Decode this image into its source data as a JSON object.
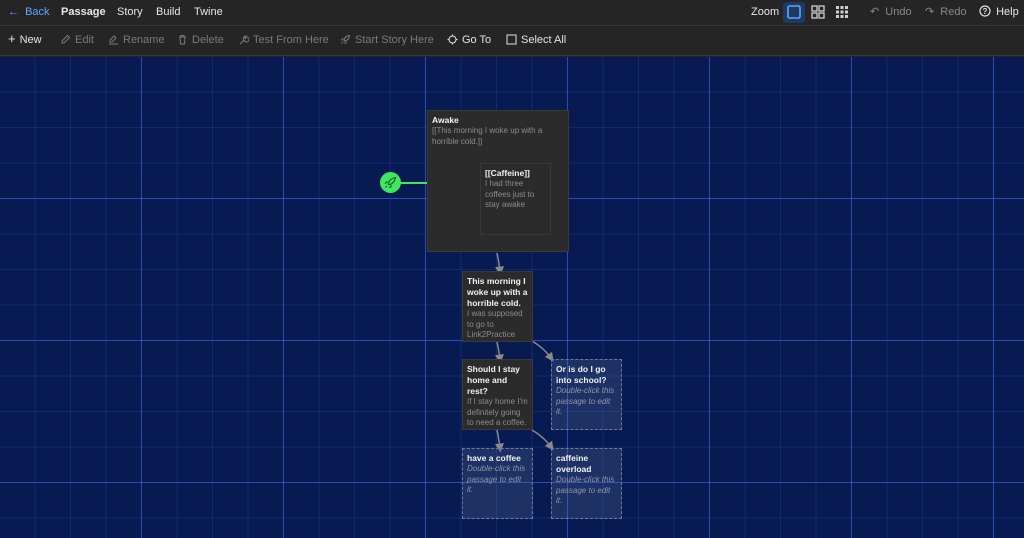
{
  "topbar": {
    "back": "Back",
    "tabs": [
      "Passage",
      "Story",
      "Build",
      "Twine"
    ],
    "zoom_label": "Zoom",
    "undo": "Undo",
    "redo": "Redo",
    "help": "Help"
  },
  "toolbar": {
    "new": "New",
    "edit": "Edit",
    "rename": "Rename",
    "delete": "Delete",
    "test_from_here": "Test From Here",
    "start_story_here": "Start Story Here",
    "go_to": "Go To",
    "select_all": "Select All"
  },
  "passages": {
    "awake": {
      "title": "Awake",
      "excerpt": "[[This morning I woke up with a horrible cold.]]"
    },
    "caffeine": {
      "title": "[[Caffeine]]",
      "excerpt": "I had three coffees just to stay awake"
    },
    "morning": {
      "title": "This morning I woke up with a horrible cold.",
      "excerpt": "I was supposed to go to Link2Practice"
    },
    "stay_home": {
      "title": "Should I stay home and rest?",
      "excerpt": "If I stay home I'm definitely going to need a coffee. [[have"
    },
    "school": {
      "title": "Or is do I go into school?",
      "excerpt": "Double-click this passage to edit it."
    },
    "have_coffee": {
      "title": "have a coffee",
      "excerpt": "Double-click this passage to edit it."
    },
    "caffeine_overload": {
      "title": "caffeine overload",
      "excerpt": "Double-click this passage to edit it."
    }
  },
  "colors": {
    "accent": "#5ba7ff",
    "start": "#3ee662",
    "canvas": "#081a52"
  },
  "icons": {
    "start": "rocket-icon",
    "zoom_levels": [
      "zoom-large-square-icon",
      "zoom-medium-grid-icon",
      "zoom-small-grid-icon"
    ]
  }
}
